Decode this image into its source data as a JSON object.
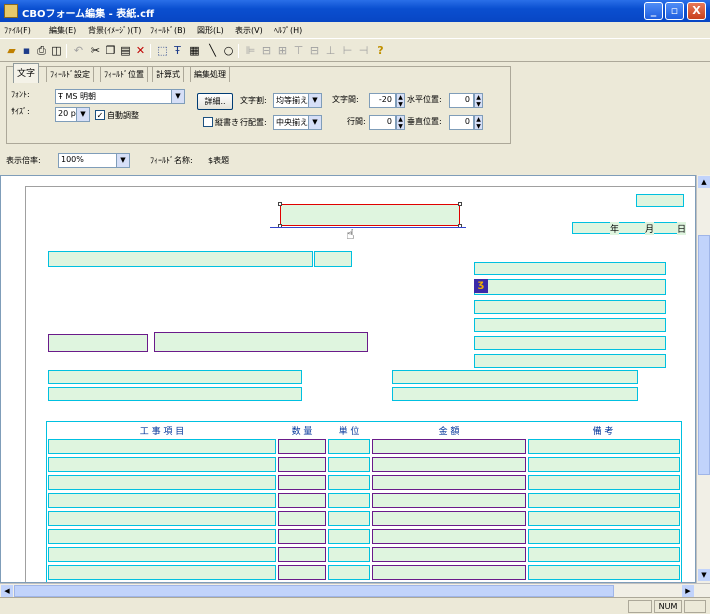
{
  "window": {
    "title": "CBOフォーム編集 - 表紙.cff",
    "minimize": "_",
    "restore": "▫",
    "close": "X"
  },
  "menu": [
    "ﾌｧｲﾙ(F)",
    "編集(E)",
    "背景(ｲﾒｰｼﾞ)(T)",
    "ﾌｨｰﾙﾄﾞ(B)",
    "図形(L)",
    "表示(V)",
    "ﾍﾙﾌﾟ(H)"
  ],
  "tabs": [
    "文字",
    "ﾌｨｰﾙﾄﾞ設定",
    "ﾌｨｰﾙﾄﾞ位置",
    "計算式",
    "編集処理"
  ],
  "props": {
    "font_label": "ﾌｫﾝﾄ:",
    "font_value": "MS 明朝",
    "size_label": "ｻｲｽﾞ:",
    "size_value": "20 p",
    "autofit_label": "自動調整",
    "detail_button": "詳細..",
    "vertical_label": "縦書き",
    "char_split_label": "文字割:",
    "char_split_value": "均等揃え",
    "line_align_label": "行配置:",
    "line_align_value": "中央揃え",
    "char_spacing_label": "文字間:",
    "char_spacing_value": "-20",
    "line_spacing_label": "行間:",
    "line_spacing_value": "0",
    "hpos_label": "水平位置:",
    "hpos_value": "0",
    "vpos_label": "垂直位置:",
    "vpos_value": "0"
  },
  "zoom": {
    "label": "表示倍率:",
    "value": "100%",
    "field_name_label": "ﾌｨｰﾙﾄﾞ名称:",
    "field_name_value": "$表題"
  },
  "form": {
    "date_year": "年",
    "date_month": "月",
    "date_day": "日",
    "table_headers": [
      "工 事 項 目",
      "数 量",
      "単 位",
      "金 額",
      "備 考"
    ]
  },
  "status": {
    "num": "NUM"
  }
}
